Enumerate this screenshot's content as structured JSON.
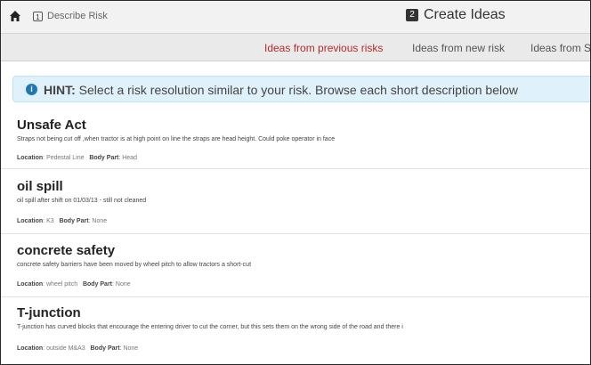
{
  "topbar": {
    "step1_number": "1",
    "step1_label": "Describe Risk",
    "step2_number": "2",
    "step2_label": "Create Ideas"
  },
  "tabs": [
    {
      "label": "Ideas from previous risks",
      "active": true
    },
    {
      "label": "Ideas from new risk",
      "active": false
    },
    {
      "label": "Ideas from S",
      "active": false
    }
  ],
  "hint": {
    "prefix": "HINT:",
    "text": "Select a risk resolution similar to your risk. Browse each short description below"
  },
  "meta_labels": {
    "location": "Location",
    "body_part": "Body Part"
  },
  "items": [
    {
      "title": "Unsafe Act",
      "description": "Straps not being cut off ,when tractor is at high point on line the straps are head height. Could poke operator in face",
      "location": "Pedestal Line",
      "body_part": "Head"
    },
    {
      "title": "oil spill",
      "description": "oil spill after shift on 01/03/13 - still not cleaned",
      "location": "K3",
      "body_part": "None"
    },
    {
      "title": "concrete safety",
      "description": "concrete safety barriers have been moved by wheel pitch to allow tractors a short-cut",
      "location": "wheel pitch",
      "body_part": "None"
    },
    {
      "title": "T-junction",
      "description": "T-junction has curved blocks that encourage the entering driver to cut the corner, but this sets them on the wrong side of the road and there i",
      "location": "outside M&A3",
      "body_part": "None"
    }
  ]
}
